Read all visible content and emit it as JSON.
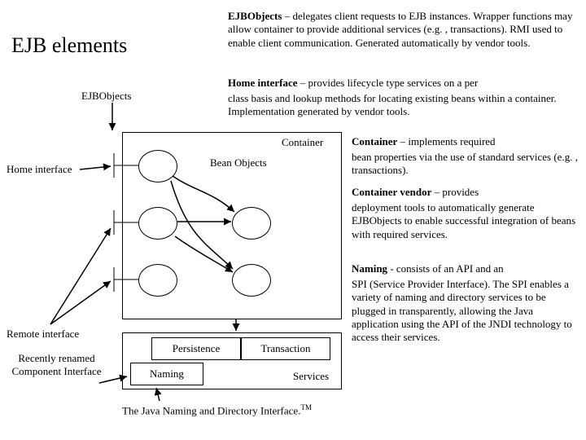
{
  "title": "EJB elements",
  "defs": {
    "ejbobjects": {
      "term": "EJBObjects",
      "text": " – delegates client requests to EJB instances. Wrapper functions may allow container to provide additional services (e.g. , transactions). RMI used to enable client communication. Generated automatically by vendor tools."
    },
    "home_interface": {
      "term": "Home interface",
      "lead": " – provides lifecycle type services on a per",
      "text": "class basis and lookup methods for locating existing beans within a container. Implementation generated by vendor tools."
    },
    "container": {
      "term": "Container",
      "lead": " – implements required",
      "text": "bean properties via the use of standard services (e.g. , transactions)."
    },
    "container_vendor": {
      "term": "Container vendor",
      "lead": " – provides",
      "text": "deployment tools to automatically generate EJBObjects to enable successful integration of beans with required services."
    },
    "naming": {
      "term": "Naming",
      "lead": " - consists of an API and an",
      "text": "SPI (Service Provider Interface). The SPI enables a variety of naming and directory services to be plugged in transparently, allowing the Java application using the API of the JNDI technology to access their services."
    }
  },
  "labels": {
    "ejbobjects": "EJBObjects",
    "home_interface": "Home interface",
    "remote_interface": "Remote interface",
    "recently_renamed": "Recently renamed Component Interface",
    "container": "Container",
    "bean_objects": "Bean Objects",
    "persistence": "Persistence",
    "transaction": "Transaction",
    "naming": "Naming",
    "services": "Services",
    "jndi_prefix": "The Java Naming and Directory Interface.",
    "jndi_tm": "TM"
  }
}
